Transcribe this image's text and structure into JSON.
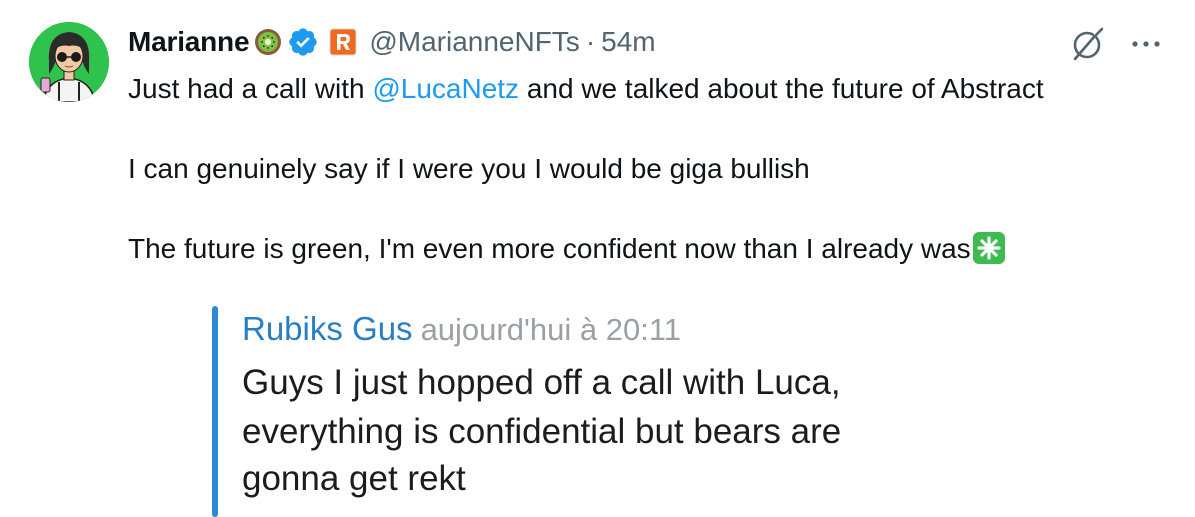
{
  "tweet": {
    "display_name": "Marianne",
    "handle": "@MarianneNFTs",
    "separator": "·",
    "time": "54m",
    "text_line1_pre": "Just had a call with ",
    "text_line1_mention": "@LucaNetz",
    "text_line1_post": " and we talked about the future of Abstract",
    "text_line2": "I can genuinely say if I were you I would be giga bullish",
    "text_line3": "The future is green, I'm even more confident now than I already was"
  },
  "quote": {
    "author": "Rubiks Gus",
    "time": "aujourd'hui à 20:11",
    "line1": "Guys I just hopped off a call with Luca,",
    "line2": "everything is confidential but bears are",
    "line3": "gonna get rekt"
  },
  "icons": {
    "kiwi": "kiwi-emoji-icon",
    "verified": "verified-badge-icon",
    "affiliate": "affiliate-badge-icon",
    "grok": "grok-icon",
    "more": "more-options-icon",
    "sparkle": "sparkle-emoji-icon"
  },
  "colors": {
    "verified_blue": "#1d9bf0",
    "mention_blue": "#1d9bf0",
    "secondary_text": "#536471",
    "avatar_bg": "#2fc24d",
    "quote_bar": "#2e88d4",
    "quote_author": "#2a7fc4",
    "sparkle_green": "#3ebb4f"
  }
}
